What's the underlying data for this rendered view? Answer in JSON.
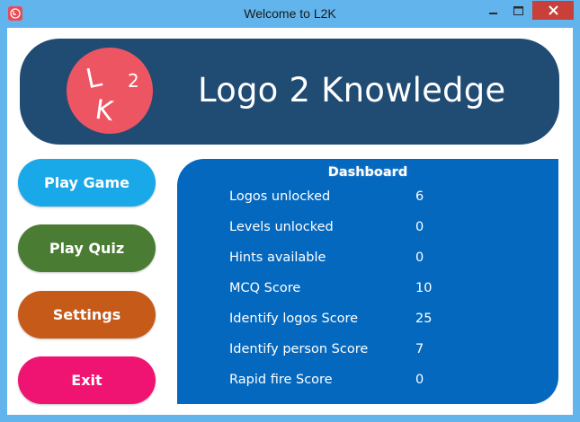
{
  "window": {
    "title": "Welcome to L2K",
    "controls": {
      "minimize_icon": "minimize-icon",
      "maximize_icon": "maximize-icon",
      "close_icon": "close-icon"
    },
    "colors": {
      "frame": "#61b4ec",
      "close": "#c9403a"
    }
  },
  "banner": {
    "logo_letters": [
      "L",
      "K",
      "2"
    ],
    "title": "Logo 2 Knowledge",
    "colors": {
      "background": "#204b73",
      "logo": "#ee5562"
    }
  },
  "menu": {
    "buttons": [
      {
        "label": "Play Game",
        "color": "#19a8e8"
      },
      {
        "label": "Play Quiz",
        "color": "#4a7d33"
      },
      {
        "label": "Settings",
        "color": "#c55a19"
      },
      {
        "label": "Exit",
        "color": "#f01472"
      }
    ]
  },
  "dashboard": {
    "title": "Dashboard",
    "background": "#0568bf",
    "rows": [
      {
        "label": "Logos unlocked",
        "value": "6"
      },
      {
        "label": "Levels unlocked",
        "value": "0"
      },
      {
        "label": "Hints available",
        "value": "0"
      },
      {
        "label": "MCQ Score",
        "value": "10"
      },
      {
        "label": "Identify logos Score",
        "value": "25"
      },
      {
        "label": "Identify person Score",
        "value": "7"
      },
      {
        "label": "Rapid fire Score",
        "value": "0"
      }
    ]
  }
}
